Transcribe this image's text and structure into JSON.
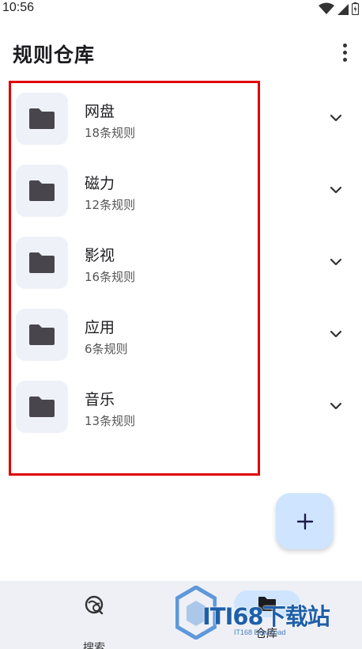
{
  "status_bar": {
    "time": "10:56"
  },
  "app_bar": {
    "title": "规则仓库"
  },
  "repositories": [
    {
      "name": "网盘",
      "count": "18条规则"
    },
    {
      "name": "磁力",
      "count": "12条规则"
    },
    {
      "name": "影视",
      "count": "16条规则"
    },
    {
      "name": "应用",
      "count": "6条规则"
    },
    {
      "name": "音乐",
      "count": "13条规则"
    }
  ],
  "bottom_nav": {
    "search_label": "搜索",
    "repo_label": "仓库",
    "active": "仓库"
  },
  "watermark": {
    "text": "ITI68下载站",
    "sub": "IT168 Download"
  },
  "colors": {
    "accent": "#cfe5ff",
    "folder_tile": "#eef1f7",
    "folder_icon": "#48464c",
    "highlight": "#e00000",
    "nav_bg": "#eef0f6",
    "watermark": "#1f5fa8"
  },
  "icons": {
    "folder": "folder-icon",
    "expand": "chevron-down-icon",
    "add": "plus-icon",
    "search_nav": "search-rule-icon",
    "repo_nav": "folder-icon",
    "more": "more-vert-icon"
  }
}
